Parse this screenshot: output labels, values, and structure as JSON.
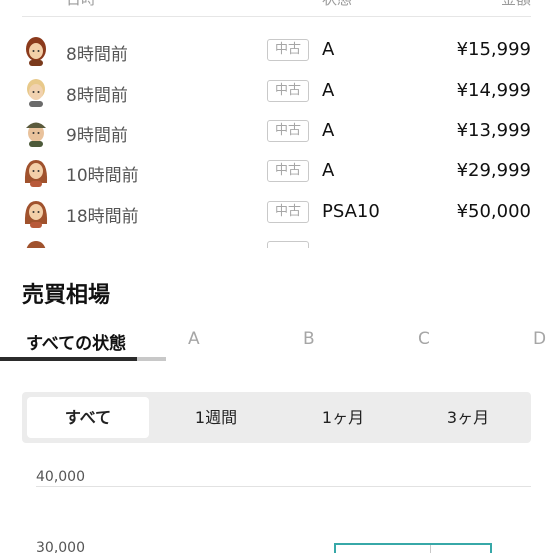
{
  "list": {
    "headers": {
      "date": "日時",
      "status": "状態",
      "amount": "金額"
    },
    "rows": [
      {
        "time": "8時間前",
        "badge": "中古",
        "condition": "A",
        "price": "¥15,999",
        "avatar": "avatar-brown-hair-icon"
      },
      {
        "time": "8時間前",
        "badge": "中古",
        "condition": "A",
        "price": "¥14,999",
        "avatar": "avatar-blonde-icon"
      },
      {
        "time": "9時間前",
        "badge": "中古",
        "condition": "A",
        "price": "¥13,999",
        "avatar": "avatar-cap-icon"
      },
      {
        "time": "10時間前",
        "badge": "中古",
        "condition": "A",
        "price": "¥29,999",
        "avatar": "avatar-long-hair-icon"
      },
      {
        "time": "18時間前",
        "badge": "中古",
        "condition": "PSA10",
        "price": "¥50,000",
        "avatar": "avatar-long-hair-icon"
      }
    ]
  },
  "market": {
    "title": "売買相場",
    "tabs": [
      "すべての状態",
      "A",
      "B",
      "C",
      "D"
    ],
    "active_tab": 0,
    "periods": [
      "すべて",
      "1週間",
      "1ヶ月",
      "3ヶ月"
    ],
    "active_period": 0
  },
  "chart_data": {
    "type": "bar",
    "y_ticks": [
      "40,000",
      "30,000"
    ],
    "accent": "#37a8a8"
  }
}
